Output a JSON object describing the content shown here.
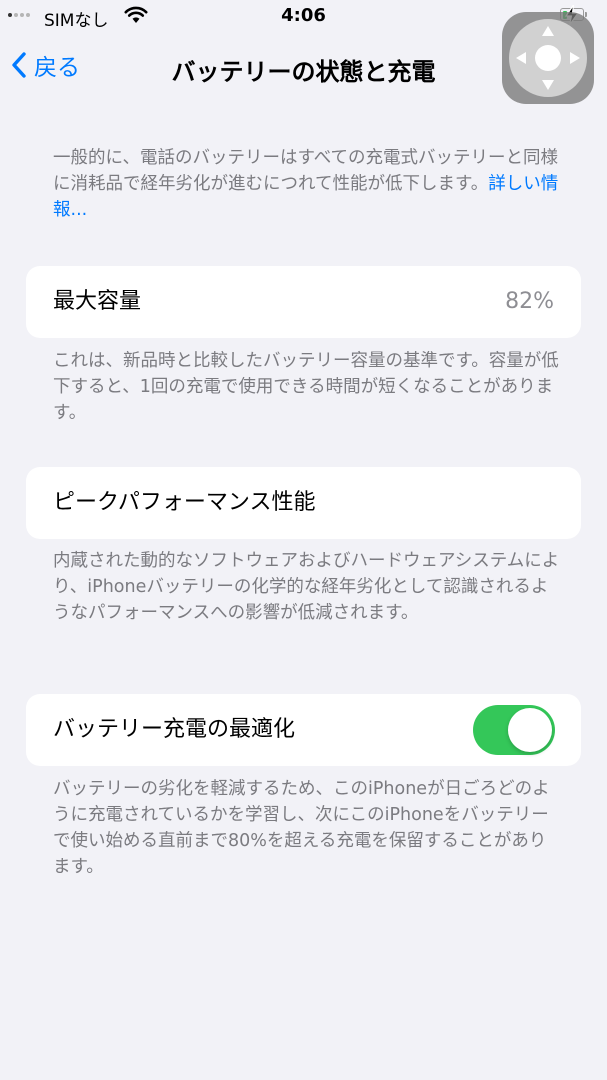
{
  "status_bar": {
    "carrier": "SIMなし",
    "time": "4:06",
    "battery_level": 0.25,
    "battery_color": "#34c759"
  },
  "nav": {
    "back_label": "戻る",
    "title": "バッテリーの状態と充電"
  },
  "intro": {
    "text": "一般的に、電話のバッテリーはすべての充電式バッテリーと同様に消耗品で経年劣化が進むにつれて性能が低下します。",
    "link": "詳しい情報..."
  },
  "max_capacity": {
    "label": "最大容量",
    "value": "82%",
    "footnote": "これは、新品時と比較したバッテリー容量の基準です。容量が低下すると、1回の充電で使用できる時間が短くなることがあります。"
  },
  "peak_performance": {
    "label": "ピークパフォーマンス性能",
    "footnote": "内蔵された動的なソフトウェアおよびハードウェアシステムにより、iPhoneバッテリーの化学的な経年劣化として認識されるようなパフォーマンスへの影響が低減されます。"
  },
  "optimized_charging": {
    "label": "バッテリー充電の最適化",
    "enabled": true,
    "footnote": "バッテリーの劣化を軽減するため、このiPhoneが日ごろどのように充電されているかを学習し、次にこのiPhoneをバッテリーで使い始める直前まで80%を超える充電を保留することがあります。"
  },
  "colors": {
    "accent": "#007aff",
    "toggle_on": "#34c759",
    "background": "#f2f2f7"
  },
  "icons": {
    "back": "chevron-left-icon",
    "wifi": "wifi-icon",
    "battery": "battery-charging-icon",
    "assistive_touch": "assistive-touch-icon"
  }
}
